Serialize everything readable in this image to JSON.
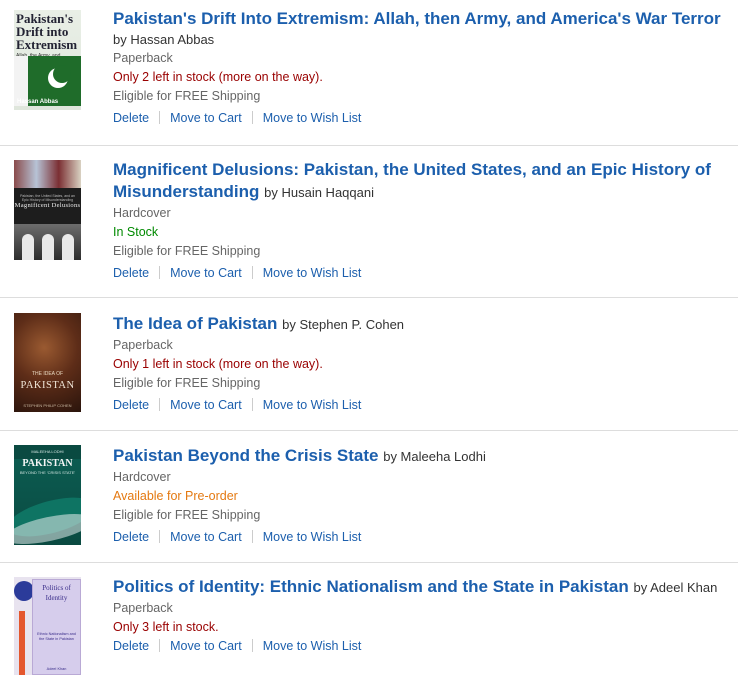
{
  "items": [
    {
      "title": "Pakistan's Drift Into Extremism: Allah, then Army, and America's War Terror",
      "author": "by Hassan Abbas",
      "format": "Paperback",
      "stock": "Only 2 left in stock (more on the way).",
      "shipping": "Eligible for FREE Shipping",
      "cover": {
        "title": "Pakistan's Drift into Extremism",
        "subtitle": "Allah, the Army, and America's War on Terror",
        "author": "Hassan Abbas"
      }
    },
    {
      "title": "Magnificent Delusions: Pakistan, the United States, and an Epic History of Misunderstanding",
      "author": "by Husain Haqqani",
      "format": "Hardcover",
      "stock": "In Stock",
      "shipping": "Eligible for FREE Shipping",
      "cover": {
        "title": "Magnificent Delusions",
        "subtitle": "Pakistan, the United States, and an Epic History of Misunderstanding"
      }
    },
    {
      "title": "The Idea of Pakistan",
      "author": "by Stephen P. Cohen",
      "format": "Paperback",
      "stock": "Only 1 left in stock (more on the way).",
      "shipping": "Eligible for FREE Shipping",
      "cover": {
        "title": "PAKISTAN",
        "subtitle": "THE IDEA OF",
        "author": "STEPHEN PHILIP COHEN"
      }
    },
    {
      "title": "Pakistan Beyond the Crisis State",
      "author": "by Maleeha Lodhi",
      "format": "Hardcover",
      "stock": "Available for Pre-order",
      "shipping": "Eligible for FREE Shipping",
      "cover": {
        "title": "PAKISTAN",
        "subtitle": "BEYOND THE 'CRISIS STATE'",
        "top": "MALEEHA LODHI"
      }
    },
    {
      "title": "Politics of Identity: Ethnic Nationalism and the State in Pakistan",
      "author": "by Adeel Khan",
      "format": "Paperback",
      "stock": "Only 3 left in stock.",
      "shipping": "",
      "cover": {
        "title": "Politics of Identity",
        "subtitle": "Ethnic Nationalism and the State in Pakistan",
        "author": "Adeel Khan"
      }
    }
  ],
  "actions": {
    "delete": "Delete",
    "move_to_cart": "Move to Cart",
    "move_to_wish_list": "Move to Wish List"
  },
  "colors": {
    "link": "#1c5fad",
    "low_stock": "#990000",
    "in_stock": "#008a00",
    "preorder": "#e47911",
    "muted": "#666666"
  }
}
